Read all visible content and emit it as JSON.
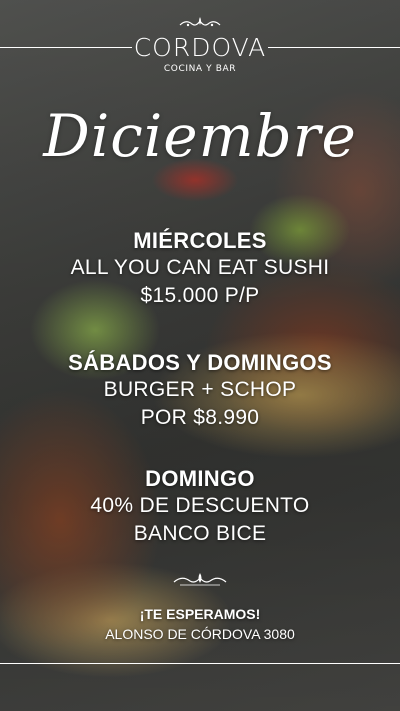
{
  "brand": {
    "name": "CORDOVA",
    "subtitle": "COCINA Y BAR"
  },
  "month_title": "Diciembre",
  "promotions": [
    {
      "day": "MIÉRCOLES",
      "lines": [
        "ALL YOU CAN EAT SUSHI",
        "$15.000 P/P"
      ]
    },
    {
      "day": "SÁBADOS Y DOMINGOS",
      "lines": [
        "BURGER + SCHOP",
        "POR $8.990"
      ]
    },
    {
      "day": "DOMINGO",
      "lines": [
        "40% DE DESCUENTO",
        "BANCO BICE"
      ]
    }
  ],
  "footer": {
    "greeting": "¡TE ESPERAMOS!",
    "address": "ALONSO DE CÓRDOVA 3080"
  },
  "icons": [
    "ornament-flourish-icon"
  ],
  "colors": {
    "text": "#ffffff",
    "background": "#4a4b48"
  }
}
